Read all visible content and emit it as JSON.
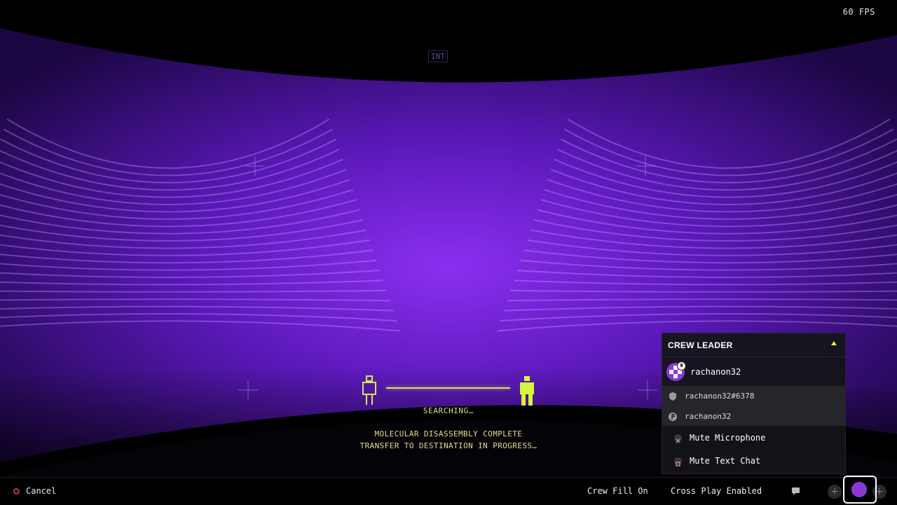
{
  "hud": {
    "fps": "60 FPS",
    "int_tag": "INT"
  },
  "matchmaking": {
    "status": "SEARCHING…",
    "line1": "MOLECULAR DISASSEMBLY COMPLETE",
    "line2": "TRANSFER TO DESTINATION IN PROGRESS…"
  },
  "crew_panel": {
    "title": "CREW LEADER",
    "leader_name": "rachanon32",
    "platform_ids": [
      {
        "icon": "shield-icon",
        "name": "rachanon32#6378"
      },
      {
        "icon": "playstation-icon",
        "name": "rachanon32"
      }
    ],
    "actions": [
      {
        "icon": "cross-button-icon",
        "label": "Mute Microphone"
      },
      {
        "icon": "square-button-icon",
        "label": "Mute Text Chat"
      }
    ]
  },
  "bottom_bar": {
    "cancel_label": "Cancel",
    "crew_fill": "Crew Fill On",
    "cross_play": "Cross Play Enabled",
    "slot_plus": "+"
  },
  "colors": {
    "accent_yellow": "#d7e64a",
    "tunnel_purple": "#7a1fd6",
    "avatar_purple": "#8a38d8"
  }
}
